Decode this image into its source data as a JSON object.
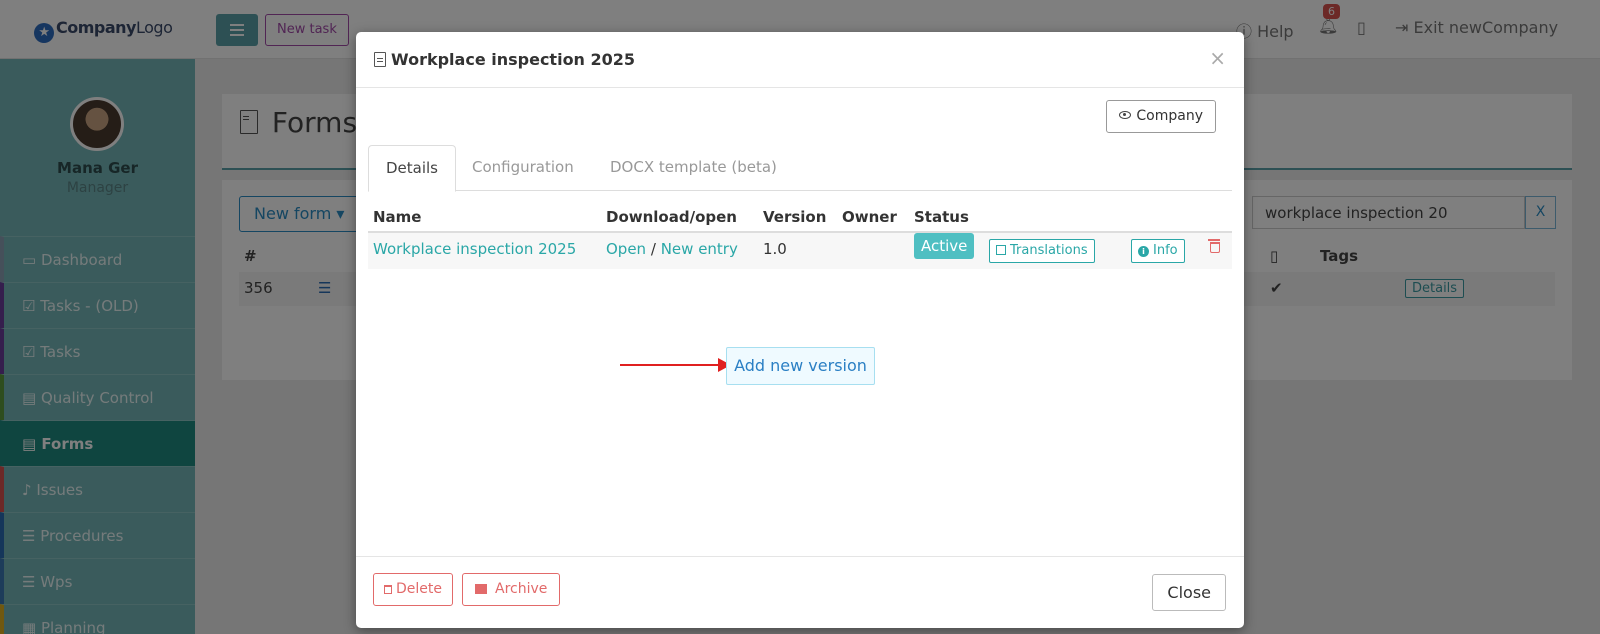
{
  "app": {
    "logo_main": "Company",
    "logo_light": "Logo",
    "new_task_label": "New task",
    "help_label": "Help",
    "notification_count": "6",
    "exit_label": "Exit newCompany"
  },
  "user": {
    "name": "Mana Ger",
    "role": "Manager"
  },
  "sidebar": {
    "items": [
      {
        "label": "Dashboard",
        "color": "#8aa0b5"
      },
      {
        "label": "Tasks - (OLD)",
        "color": "#6a3d9a"
      },
      {
        "label": "Tasks",
        "color": "#6a3d9a"
      },
      {
        "label": "Quality Control",
        "color": "#5c9a3d"
      },
      {
        "label": "Forms",
        "color": "#1f8a80"
      },
      {
        "label": "Issues",
        "color": "#d9534f"
      },
      {
        "label": "Procedures",
        "color": "#2a6cb4"
      },
      {
        "label": "Wps",
        "color": "#3a78b4"
      },
      {
        "label": "Planning",
        "color": "#e0b020"
      }
    ]
  },
  "page": {
    "title": "Forms",
    "new_form_label": "New form",
    "search_value": "workplace inspection 20",
    "search_clear": "X",
    "table_headers": {
      "id": "#",
      "tags": "Tags"
    },
    "row": {
      "id": "356",
      "details": "Details"
    }
  },
  "modal": {
    "title": "Workplace inspection 2025",
    "company_button": "Company",
    "tabs": [
      "Details",
      "Configuration",
      "DOCX template (beta)"
    ],
    "columns": [
      "Name",
      "Download/open",
      "Version",
      "Owner",
      "Status"
    ],
    "row": {
      "name": "Workplace inspection 2025",
      "open": "Open",
      "separator": "/",
      "new_entry": "New entry",
      "version": "1.0",
      "owner": "",
      "status": "Active",
      "translations": "Translations",
      "info": "Info"
    },
    "add_version_label": "Add new version",
    "footer": {
      "delete": "Delete",
      "archive": "Archive",
      "close": "Close"
    }
  }
}
